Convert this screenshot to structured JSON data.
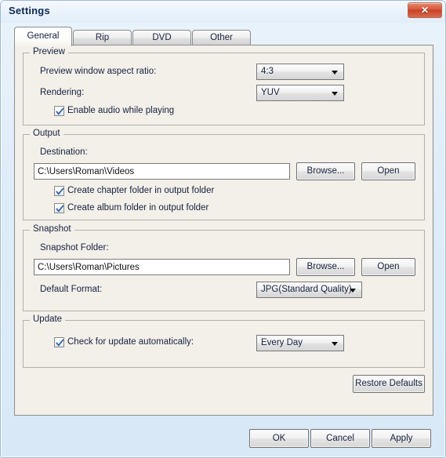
{
  "window": {
    "title": "Settings",
    "close_label": "✕"
  },
  "tabs": [
    {
      "label": "General",
      "active": true
    },
    {
      "label": "Rip",
      "active": false
    },
    {
      "label": "DVD",
      "active": false
    },
    {
      "label": "Other",
      "active": false
    }
  ],
  "preview": {
    "group_title": "Preview",
    "aspect_label": "Preview window aspect ratio:",
    "aspect_value": "4:3",
    "rendering_label": "Rendering:",
    "rendering_value": "YUV",
    "enable_audio_label": "Enable audio while playing",
    "enable_audio_checked": true
  },
  "output": {
    "group_title": "Output",
    "destination_label": "Destination:",
    "destination_value": "C:\\Users\\Roman\\Videos",
    "destination_placeholder": "C:\\Users\\Roman\\Videos",
    "browse_label": "Browse...",
    "open_label": "Open",
    "chapter_folder_label": "Create chapter folder in output folder",
    "chapter_folder_checked": true,
    "album_folder_label": "Create album folder in output folder",
    "album_folder_checked": true
  },
  "snapshot": {
    "group_title": "Snapshot",
    "folder_label": "Snapshot Folder:",
    "folder_value": "C:\\Users\\Roman\\Pictures",
    "folder_placeholder": "C:\\Users\\Roman\\Pictures",
    "browse_label": "Browse...",
    "open_label": "Open",
    "format_label": "Default Format:",
    "format_value": "JPG(Standard Quality)"
  },
  "update": {
    "group_title": "Update",
    "check_label": "Check for update automatically:",
    "check_checked": true,
    "frequency_value": "Every Day"
  },
  "restore": {
    "label": "Restore Defaults"
  },
  "footer": {
    "ok_label": "OK",
    "cancel_label": "Cancel",
    "apply_label": "Apply"
  },
  "colors": {
    "dialog_background": "#dfecf9",
    "panel_background": "#f3f0ea",
    "close_button": "#c64128",
    "text": "#16213e",
    "group_border": "#b4b0a8",
    "check_mark": "#2f5fa8"
  }
}
